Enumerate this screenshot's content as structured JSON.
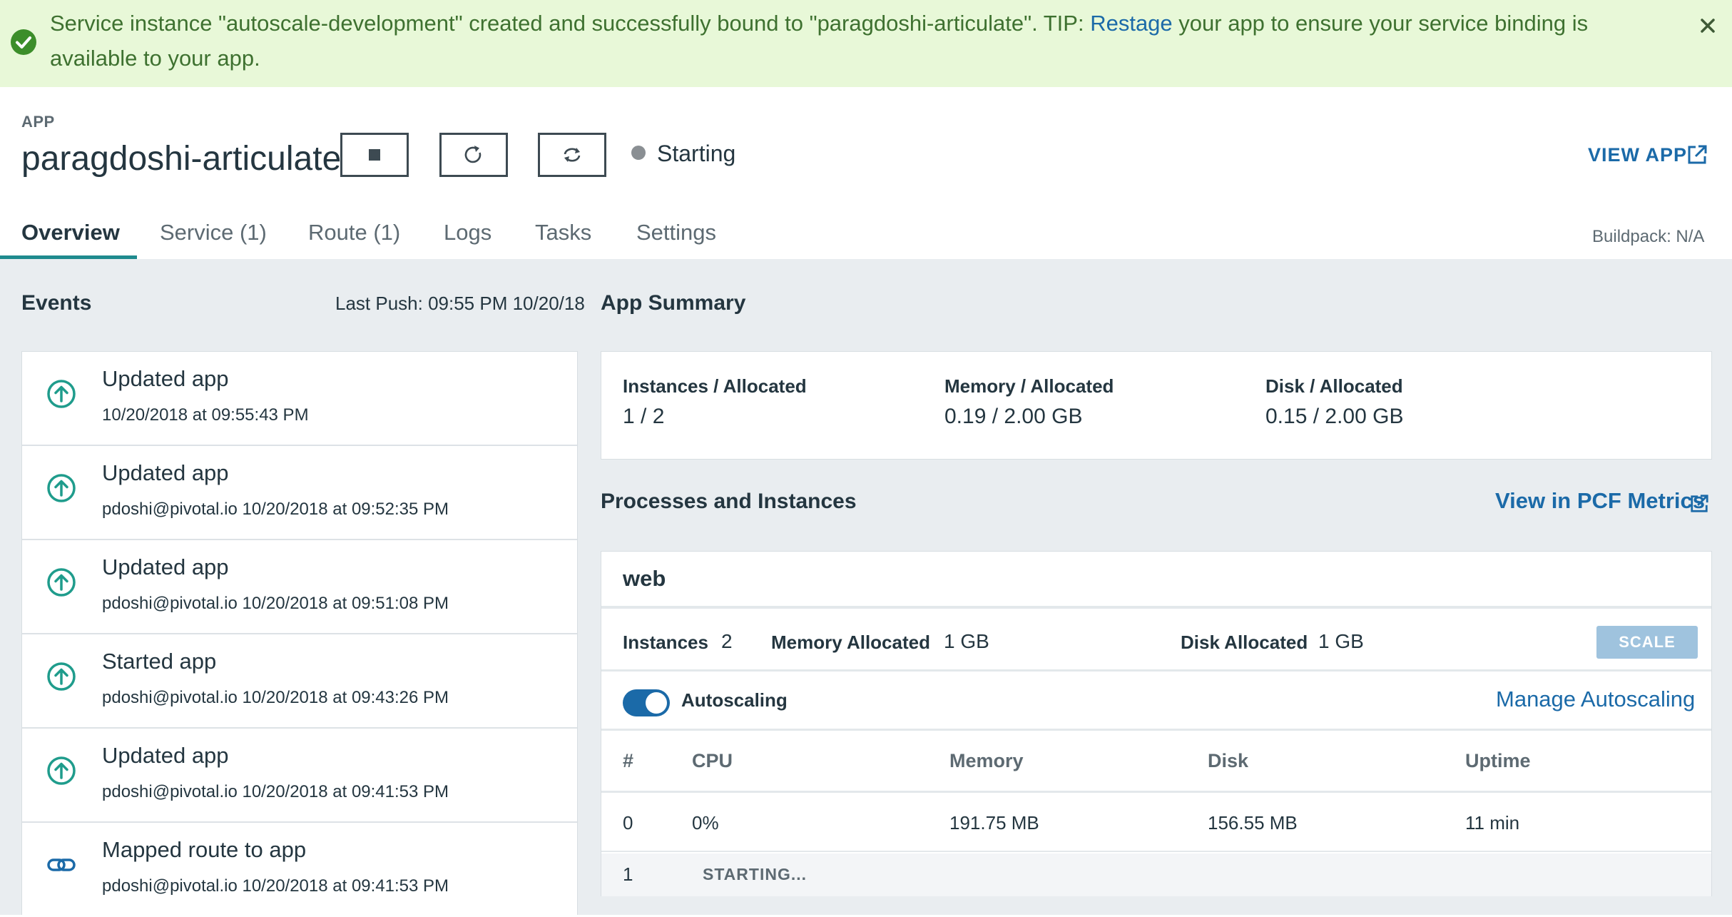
{
  "alert": {
    "text_before": "Service instance \"autoscale-development\" created and successfully bound to \"paragdoshi-articulate\". TIP: ",
    "link": "Restage",
    "text_after": " your app to ensure your service binding is available to your app.",
    "status_color": "#3c8e2a"
  },
  "header": {
    "eyebrow": "APP",
    "app_name": "paragdoshi-articulate",
    "status": "Starting",
    "view_app": "VIEW APP"
  },
  "tabs": [
    {
      "label": "Overview"
    },
    {
      "label": "Service (1)"
    },
    {
      "label": "Route (1)"
    },
    {
      "label": "Logs"
    },
    {
      "label": "Tasks"
    },
    {
      "label": "Settings"
    }
  ],
  "buildpack": "Buildpack: N/A",
  "events": {
    "title": "Events",
    "last_push": "Last Push: 09:55 PM 10/20/18",
    "items": [
      {
        "title": "Updated app",
        "meta": "10/20/2018 at 09:55:43 PM",
        "icon": "arrow-up-circle-icon"
      },
      {
        "title": "Updated app",
        "meta": "pdoshi@pivotal.io 10/20/2018 at 09:52:35 PM",
        "icon": "arrow-up-circle-icon"
      },
      {
        "title": "Updated app",
        "meta": "pdoshi@pivotal.io 10/20/2018 at 09:51:08 PM",
        "icon": "arrow-up-circle-icon"
      },
      {
        "title": "Started app",
        "meta": "pdoshi@pivotal.io 10/20/2018 at 09:43:26 PM",
        "icon": "arrow-up-circle-icon"
      },
      {
        "title": "Updated app",
        "meta": "pdoshi@pivotal.io 10/20/2018 at 09:41:53 PM",
        "icon": "arrow-up-circle-icon"
      },
      {
        "title": "Mapped route to app",
        "meta": "pdoshi@pivotal.io 10/20/2018 at 09:41:53 PM",
        "icon": "link-icon"
      }
    ]
  },
  "summary": {
    "title": "App Summary",
    "instances_label": "Instances / Allocated",
    "instances_value": "1 / 2",
    "memory_label": "Memory / Allocated",
    "memory_value": "0.19 / 2.00 GB",
    "disk_label": "Disk / Allocated",
    "disk_value": "0.15 / 2.00 GB"
  },
  "processes": {
    "title": "Processes and Instances",
    "metrics_link": "View in PCF Metrics",
    "process_name": "web",
    "instances_label": "Instances",
    "instances_value": "2",
    "memory_label": "Memory Allocated",
    "memory_value": "1 GB",
    "disk_label": "Disk Allocated",
    "disk_value": "1 GB",
    "scale_label": "SCALE",
    "autoscaling_label": "Autoscaling",
    "autoscaling_on": true,
    "manage_link": "Manage Autoscaling",
    "columns": [
      "#",
      "CPU",
      "Memory",
      "Disk",
      "Uptime"
    ],
    "rows": [
      {
        "index": "0",
        "cpu": "0%",
        "memory": "191.75 MB",
        "disk": "156.55 MB",
        "uptime": "11 min"
      },
      {
        "index": "1",
        "state": "STARTING..."
      }
    ]
  },
  "colors": {
    "accent": "#1b6aa8",
    "tab_underline": "#1f8a8e",
    "event_icon": "#1f9c8c",
    "alert_bg": "#e8f8d8"
  }
}
